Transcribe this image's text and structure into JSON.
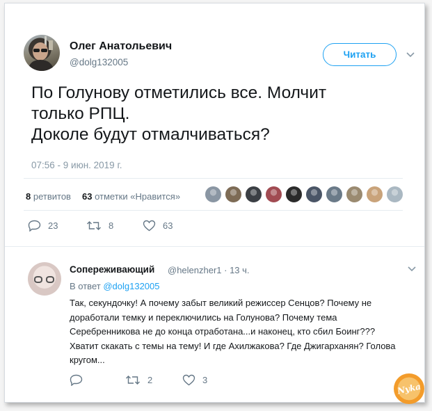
{
  "tweet": {
    "author_name": "Олег Анатольевич",
    "author_handle": "@dolg132005",
    "follow_label": "Читать",
    "text": "По Голунову отметились все. Молчит\nтолько РПЦ.\nДоколе будут отмалчиваться?",
    "timestamp": "07:56 - 9 июн. 2019 г.",
    "retweets_count": "8",
    "retweets_label": "ретвитов",
    "likes_count": "63",
    "likes_label": "отметки «Нравится»",
    "actions": {
      "replies": "23",
      "retweets": "8",
      "likes": "63"
    },
    "liker_colors": [
      "#8a96a3",
      "#7d6b55",
      "#3b3f44",
      "#a14b52",
      "#2a2a2a",
      "#4a5566",
      "#6a7a88",
      "#9a8a70",
      "#c9a37a",
      "#aab8c2"
    ]
  },
  "reply": {
    "author_name": "Сопереживающий",
    "meta": "@helenzher1 · 13 ч.",
    "reply_to_prefix": "В ответ",
    "reply_to_handle": "@dolg132005",
    "text": "Так, секундочку! А почему забыт великий режиссер Сенцов? Почему не доработали темку и переключились на Голунова? Почему тема Серебренникова не до конца отработана...и наконец, кто сбил Боинг??? Хватит скакать с темы на тему!  И где Ахилжакова? Где Джигарханян? Голова кругом...",
    "actions": {
      "replies": "",
      "retweets": "2",
      "likes": "3"
    }
  },
  "watermark": "Nyka",
  "colors": {
    "accent": "#1da1f2",
    "muted": "#657786"
  }
}
